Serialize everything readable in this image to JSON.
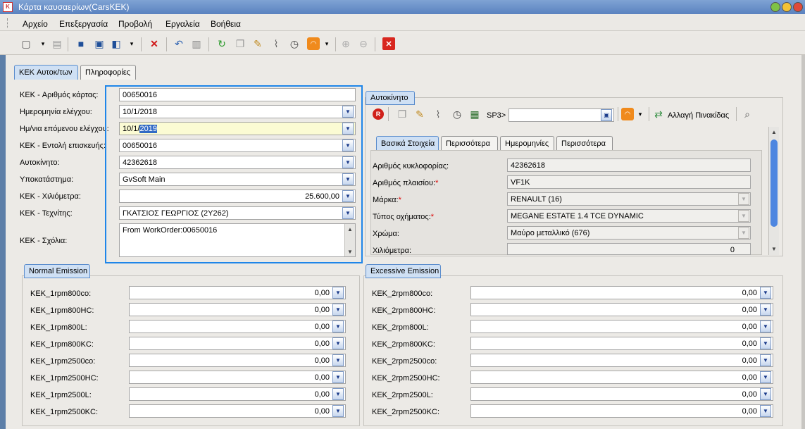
{
  "window": {
    "title": "Κάρτα καυσαερίων(CarsKEK)"
  },
  "menu": [
    "Αρχείο",
    "Επεξεργασία",
    "Προβολή",
    "Εργαλεία",
    "Βοήθεια"
  ],
  "tabs": [
    "KEK Αυτοκ/των",
    "Πληροφορίες"
  ],
  "form": {
    "card_label": "KEK - Αριθμός κάρτας:",
    "card_value": "00650016",
    "check_date_label": "Ημερομηνία ελέγχου:",
    "check_date_value": "10/1/2018",
    "next_check_label": "Ημ/νια επόμενου ελέγχου:",
    "next_check_prefix": "10/1/",
    "next_check_sel": "2019",
    "repair_label": "KEK - Εντολή επισκευής:",
    "repair_value": "00650016",
    "car_label": "Αυτοκίνητο:",
    "car_value": "42362618",
    "branch_label": "Υποκατάστημα:",
    "branch_value": "GvSoft Main",
    "km_label": "KEK - Χιλιόμετρα:",
    "km_value": "25.600,00",
    "tech_label": "KEK - Τεχνίτης:",
    "tech_value": "ΓΚΑΤΣΙΟΣ  ΓΕΩΡΓΙΟΣ (2Y262)",
    "comments_label": "KEK - Σχόλια:",
    "comments_value": "From WorkOrder:00650016"
  },
  "car_panel": {
    "title": "Αυτοκίνητο",
    "toolbar": {
      "sp3_label": "SP3>",
      "sp3_value": "",
      "change_plate": "Αλλαγή Πινακίδας"
    },
    "tabs": [
      "Βασικά Στοιχεία",
      "Περισσότερα",
      "Ημερομηνίες",
      "Περισσότερα"
    ],
    "plate_label": "Αριθμός κυκλοφορίας:",
    "plate_value": "42362618",
    "vin_label": "Αριθμός πλαισίου:",
    "vin_value": "VF1K",
    "brand_label": "Μάρκα:",
    "brand_value": "RENAULT (16)",
    "type_label": "Τύπος οχήματος:",
    "type_value": "MEGANE ESTATE 1.4 TCE DYNAMIC",
    "color_label": "Χρώμα:",
    "color_value": "Μαύρο μεταλλικό (676)",
    "km_label": "Χιλιόμετρα:",
    "km_value": "0"
  },
  "normal_emission": {
    "title": "Normal Emission",
    "rows": [
      {
        "label": "KEK_1rpm800co:",
        "value": "0,00"
      },
      {
        "label": "KEK_1rpm800HC:",
        "value": "0,00"
      },
      {
        "label": "KEK_1rpm800L:",
        "value": "0,00"
      },
      {
        "label": "KEK_1rpm800KC:",
        "value": "0,00"
      },
      {
        "label": "KEK_1rpm2500co:",
        "value": "0,00"
      },
      {
        "label": "KEK_1rpm2500HC:",
        "value": "0,00"
      },
      {
        "label": "KEK_1rpm2500L:",
        "value": "0,00"
      },
      {
        "label": "KEK_1rpm2500KC:",
        "value": "0,00"
      }
    ]
  },
  "excessive_emission": {
    "title": "Excessive Emission",
    "rows": [
      {
        "label": "KEK_2rpm800co:",
        "value": "0,00"
      },
      {
        "label": "KEK_2rpm800HC:",
        "value": "0,00"
      },
      {
        "label": "KEK_2rpm800L:",
        "value": "0,00"
      },
      {
        "label": "KEK_2rpm800KC:",
        "value": "0,00"
      },
      {
        "label": "KEK_2rpm2500co:",
        "value": "0,00"
      },
      {
        "label": "KEK_2rpm2500HC:",
        "value": "0,00"
      },
      {
        "label": "KEK_2rpm2500L:",
        "value": "0,00"
      },
      {
        "label": "KEK_2rpm2500KC:",
        "value": "0,00"
      }
    ]
  },
  "colors": {
    "title_bar": "#5a82c0",
    "highlight_box": "#1f86e9",
    "active_tab": "#cfe0f4",
    "required": "#dd0000"
  },
  "icons": [
    "new-icon",
    "save-icon",
    "delete-icon",
    "undo-icon",
    "refresh-icon",
    "attach-icon",
    "clock-icon",
    "rss-icon",
    "close-red-icon"
  ]
}
